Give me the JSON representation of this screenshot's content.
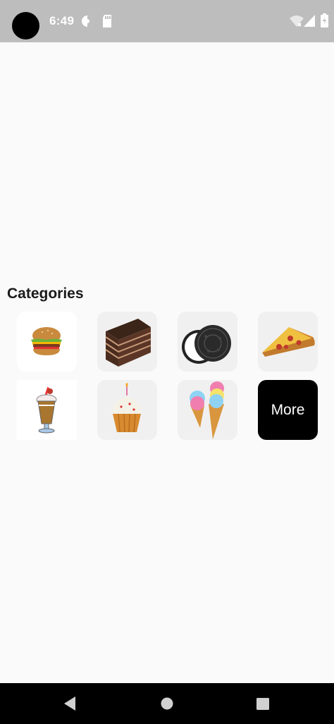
{
  "status_bar": {
    "time": "6:49",
    "icons": [
      "camera-dot",
      "data-saver-icon",
      "sd-card-icon",
      "wifi-icon",
      "signal-icon",
      "battery-icon"
    ]
  },
  "section": {
    "title": "Categories"
  },
  "categories": [
    {
      "icon": "burger-icon"
    },
    {
      "icon": "cake-slice-icon"
    },
    {
      "icon": "cookie-icon"
    },
    {
      "icon": "pizza-slice-icon"
    },
    {
      "icon": "milkshake-icon"
    },
    {
      "icon": "cupcake-icon"
    },
    {
      "icon": "ice-cream-icon"
    },
    {
      "label": "More"
    }
  ],
  "nav": {
    "buttons": [
      "back-icon",
      "home-icon",
      "recents-icon"
    ]
  },
  "colors": {
    "status_bar": "#bdbdbd",
    "background": "#fafafa",
    "more_tile": "#000000"
  }
}
